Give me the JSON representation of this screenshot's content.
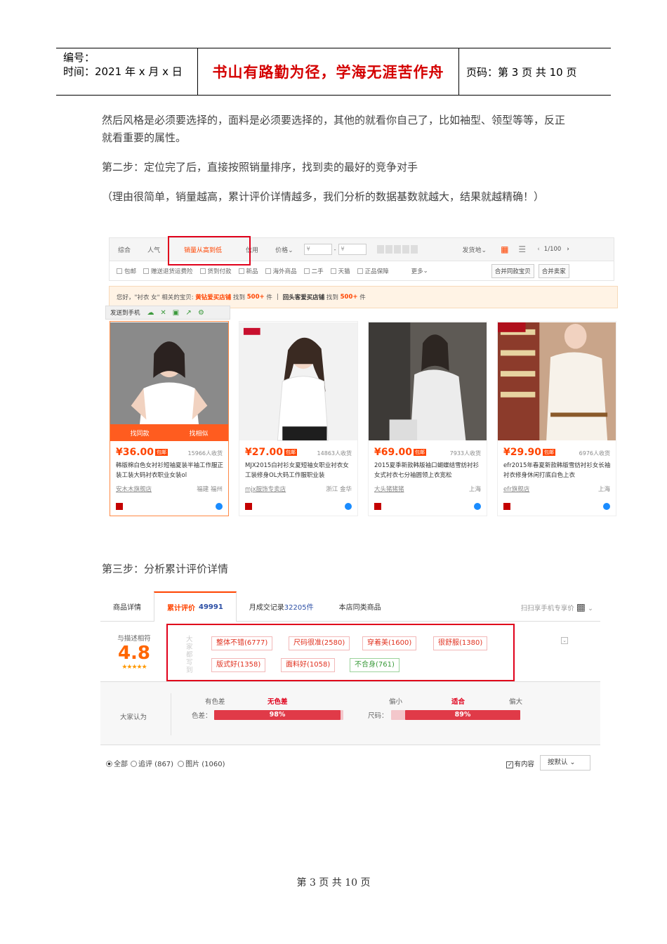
{
  "header": {
    "number_label": "编号：",
    "time_label": "时间：2021 年 x 月 x 日",
    "motto": "书山有路勤为径，学海无涯苦作舟",
    "page_label": "页码：第 3 页  共 10 页"
  },
  "paragraphs": {
    "p1": "然后风格是必须要选择的，面料是必须要选择的，其他的就看你自己了，比如袖型、领型等等，反正就看重要的属性。",
    "p2": "第二步：定位完了后，直接按照销量排序，找到卖的最好的竞争对手",
    "p3": "（理由很简单，销量越高，累计评价详情越多，我们分析的数据基数就越大，结果就越精确！）",
    "p4": "第三步：分析累计评价详情"
  },
  "search": {
    "tabs": [
      "综合",
      "人气",
      "销量从高到低",
      "信用",
      "价格"
    ],
    "price_from": "¥",
    "price_to": "¥",
    "ship_from": "发货地",
    "page_indicator": "1/100",
    "filters": [
      "包邮",
      "赠送退货运费险",
      "货到付款",
      "新品",
      "海外商品",
      "二手",
      "天猫",
      "正品保障",
      "更多"
    ],
    "merge_buttons": [
      "合并同款宝贝",
      "合并卖家"
    ],
    "notice_prefix": "您好，\"衬衣 女\" 相关的宝贝:",
    "notice_shop1": "黄钻爱买店铺",
    "notice_mid": "找到",
    "notice_count1": "500+",
    "notice_unit": "件",
    "notice_shop2": "回头客爱买店铺",
    "notice_count2": "500+",
    "send_phone": "发送到手机",
    "overlay_btns": [
      "找同款",
      "找相似"
    ],
    "products": [
      {
        "price": "¥36.00",
        "tag": "包邮",
        "sales": "15966人收货",
        "title": "韩版棉白色女衬衫短袖夏装半袖工作服正装工装大码衬衣职业女装ol",
        "shop": "安木木旗舰店",
        "loc": "福建 福州"
      },
      {
        "price": "¥27.00",
        "tag": "包邮",
        "sales": "14863人收货",
        "title": "MJX2015白衬衫女夏短袖女职业衬衣女工装修身OL大码工作服职业装",
        "shop": "mjx服饰专卖店",
        "loc": "浙江 金华"
      },
      {
        "price": "¥69.00",
        "tag": "包邮",
        "sales": "7933人收货",
        "title": "2015夏季新款韩版袖口蝴蝶结雪纺衬衫女式衬衣七分袖圆领上衣宽松",
        "shop": "大头猪猪猪",
        "loc": "上海"
      },
      {
        "price": "¥29.90",
        "tag": "包邮",
        "sales": "6976人收货",
        "title": "efr2015年春夏新款韩版雪纺衬衫女长袖衬衣修身休闲打底白色上衣",
        "shop": "efr旗舰店",
        "loc": "上海"
      }
    ]
  },
  "review": {
    "tabs": [
      "商品详情",
      "累计评价",
      "月成交记录",
      "本店同类商品"
    ],
    "review_count": "49991",
    "monthly_count": "32205件",
    "qr_text": "扫扫享手机专享价",
    "score_label": "与描述相符",
    "score": "4.8",
    "stars": "★★★★★",
    "vertical_label": "大家都写到",
    "tags": [
      "整体不错(6777)",
      "尺码很准(2580)",
      "穿着美(1600)",
      "很舒服(1380)",
      "版式好(1358)",
      "面料好(1058)",
      "不合身(761)"
    ],
    "opinion_label": "大家认为",
    "color": {
      "label": "色差：",
      "left": "有色差",
      "center": "无色差",
      "percent": "98%",
      "fill": 0.98
    },
    "size": {
      "label": "尺码：",
      "left": "偏小",
      "center": "适合",
      "right": "偏大",
      "percent": "89%",
      "fill": 0.89
    },
    "filters": [
      "全部",
      "追评 (867)",
      "图片 (1060)"
    ],
    "has_content": "有内容",
    "sort": "按默认"
  },
  "footer": "第 3 页  共 10 页"
}
